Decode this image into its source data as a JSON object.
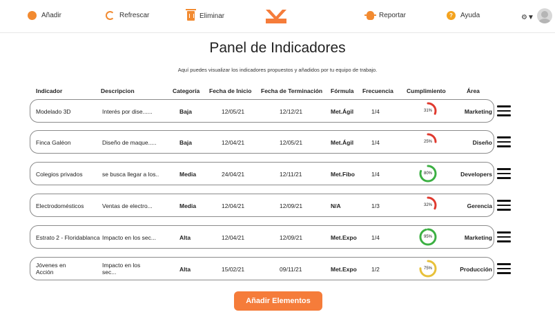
{
  "toolbar": {
    "add_label": "Añadir",
    "refresh_label": "Refrescar",
    "delete_label": "Eliminar",
    "report_label": "Reportar",
    "help_label": "Ayuda",
    "settings_icon": "gear-icon"
  },
  "page": {
    "title": "Panel de Indicadores",
    "subtitle": "Aquí puedes visualizar los indicadores propuestos y añadidos por tu equipo de trabajo."
  },
  "table": {
    "headers": {
      "indicador": "Indicador",
      "descripcion": "Descripcion",
      "categoria": "Categoría",
      "fecha_inicio": "Fecha de Inicio",
      "fecha_terminacion": "Fecha de Terminación",
      "formula": "Fórmula",
      "frecuencia": "Frecuencia",
      "cumplimiento": "Cumplimiento",
      "area": "Área"
    },
    "rows": [
      {
        "indicador": "Modelado 3D",
        "descripcion": "Interés por dise......",
        "categoria": "Baja",
        "fecha_inicio": "12/05/21",
        "fecha_terminacion": "12/12/21",
        "formula": "Met.Ágil",
        "frecuencia": "1/4",
        "cumplimiento": "31%",
        "cumplimiento_value": 0.31,
        "gauge_color": "#e03a2f",
        "area": "Marketing"
      },
      {
        "indicador": "Finca Galéon",
        "descripcion": "Diseño de maque.....",
        "categoria": "Baja",
        "fecha_inicio": "12/04/21",
        "fecha_terminacion": "12/05/21",
        "formula": "Met.Ágil",
        "frecuencia": "1/4",
        "cumplimiento": "25%",
        "cumplimiento_value": 0.25,
        "gauge_color": "#e03a2f",
        "area": "Diseño"
      },
      {
        "indicador": "Colegios privados",
        "descripcion": "se busca llegar a los..",
        "categoria": "Media",
        "fecha_inicio": "24/04/21",
        "fecha_terminacion": "12/11/21",
        "formula": "Met.Fibo",
        "frecuencia": "1/4",
        "cumplimiento": "80%",
        "cumplimiento_value": 0.8,
        "gauge_color": "#3cb043",
        "area": "Developers"
      },
      {
        "indicador": "Electrodomésticos",
        "descripcion": "Ventas de electro...",
        "categoria": "Media",
        "fecha_inicio": "12/04/21",
        "fecha_terminacion": "12/09/21",
        "formula": "N/A",
        "frecuencia": "1/3",
        "cumplimiento": "32%",
        "cumplimiento_value": 0.32,
        "gauge_color": "#e03a2f",
        "area": "Gerencia"
      },
      {
        "indicador": "Estrato 2 - Floridablanca",
        "descripcion": "Impacto en los sec...",
        "categoria": "Alta",
        "fecha_inicio": "12/04/21",
        "fecha_terminacion": "12/09/21",
        "formula": "Met.Expo",
        "frecuencia": "1/4",
        "cumplimiento": "95%",
        "cumplimiento_value": 0.95,
        "gauge_color": "#3cb043",
        "area": "Marketing"
      },
      {
        "indicador": "Jóvenes en Acción",
        "descripcion": "Impacto en los sec...",
        "categoria": "Alta",
        "fecha_inicio": "15/02/21",
        "fecha_terminacion": "09/11/21",
        "formula": "Met.Expo",
        "frecuencia": "1/2",
        "cumplimiento": "75%",
        "cumplimiento_value": 0.75,
        "gauge_color": "#e8c13a",
        "area": "Producción"
      }
    ]
  },
  "add_elements_label": "Añadir Elementos"
}
